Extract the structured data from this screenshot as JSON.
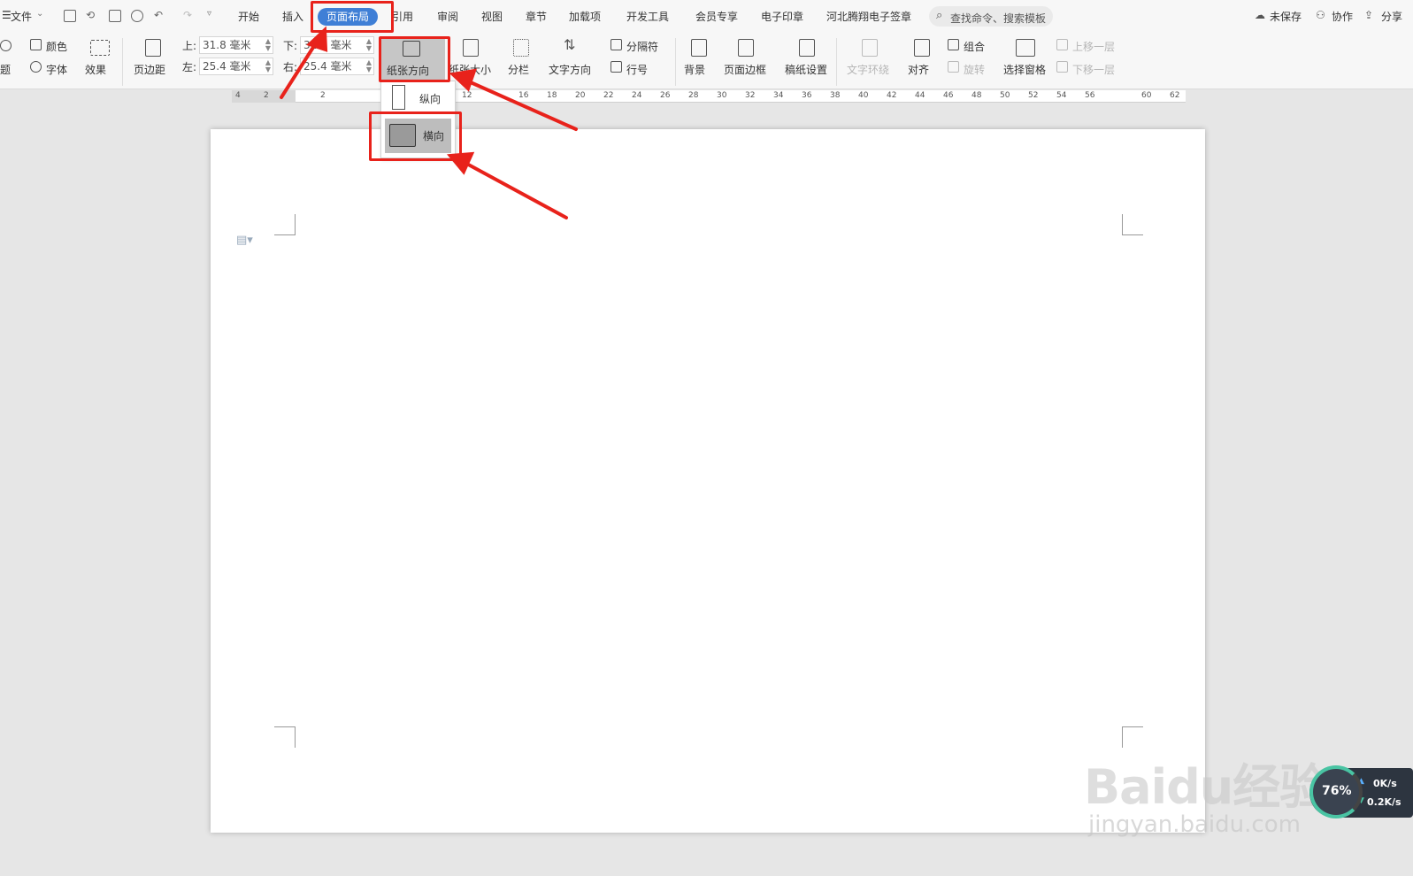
{
  "menubar": {
    "file_label": "文件",
    "tabs": [
      "开始",
      "插入",
      "页面布局",
      "引用",
      "审阅",
      "视图",
      "章节",
      "加载项",
      "开发工具",
      "会员专享",
      "电子印章",
      "河北腾翔电子签章"
    ],
    "search_label": "查找命令、搜索模板",
    "unsaved_label": "未保存",
    "collab_label": "协作",
    "share_label": "分享"
  },
  "ribbon": {
    "theme_label": "题",
    "color_label": "颜色",
    "font_label": "字体",
    "effect_label": "效果",
    "margin_label": "页边距",
    "margin_top_label": "上:",
    "margin_top_value": "31.8 毫米",
    "margin_left_label": "左:",
    "margin_left_value": "25.4 毫米",
    "margin_bottom_label": "下:",
    "margin_bottom_value": "31.8 毫米",
    "margin_right_label": "右:",
    "margin_right_value": "25.4 毫米",
    "orientation_label": "纸张方向",
    "size_label": "纸张大小",
    "columns_label": "分栏",
    "text_direction_label": "文字方向",
    "separator_label": "分隔符",
    "line_number_label": "行号",
    "background_label": "背景",
    "page_border_label": "页面边框",
    "manuscript_label": "稿纸设置",
    "text_wrap_label": "文字环绕",
    "align_label": "对齐",
    "group_label": "组合",
    "rotate_label": "旋转",
    "selection_pane_label": "选择窗格",
    "bring_forward_label": "上移一层",
    "send_backward_label": "下移一层"
  },
  "dropdown": {
    "portrait_label": "纵向",
    "landscape_label": "横向"
  },
  "ruler": {
    "ticks": [
      "4",
      "2",
      "2",
      "12",
      "16",
      "18",
      "20",
      "22",
      "24",
      "26",
      "28",
      "30",
      "32",
      "34",
      "36",
      "38",
      "40",
      "42",
      "44",
      "46",
      "48",
      "50",
      "52",
      "54",
      "56",
      "60",
      "62"
    ]
  },
  "speed_widget": {
    "percent": "76%",
    "up_speed": "0K/s",
    "down_speed": "0.2K/s"
  },
  "watermark": {
    "brand": "Baidu经验",
    "url": "jingyan.baidu.com"
  },
  "colors": {
    "accent": "#3f7fd6",
    "annotation": "#e8221b"
  }
}
